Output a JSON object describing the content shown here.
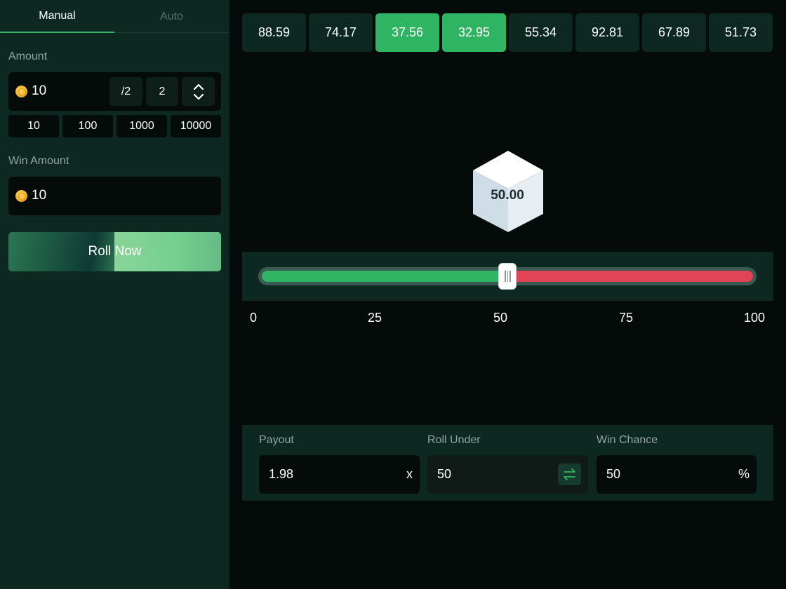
{
  "sidebar": {
    "tabs": [
      {
        "label": "Manual",
        "active": true
      },
      {
        "label": "Auto",
        "active": false
      }
    ],
    "amount": {
      "label": "Amount",
      "value": "10",
      "half_label": "/2",
      "double_label": "2",
      "presets": [
        "10",
        "100",
        "1000",
        "10000"
      ]
    },
    "win_amount": {
      "label": "Win Amount",
      "value": "10"
    },
    "roll_button_label": "Roll Now"
  },
  "history": [
    {
      "value": "88.59",
      "win": false
    },
    {
      "value": "74.17",
      "win": false
    },
    {
      "value": "37.56",
      "win": true
    },
    {
      "value": "32.95",
      "win": true
    },
    {
      "value": "55.34",
      "win": false
    },
    {
      "value": "92.81",
      "win": false
    },
    {
      "value": "67.89",
      "win": false
    },
    {
      "value": "51.73",
      "win": false
    }
  ],
  "dice": {
    "value": "50.00"
  },
  "slider": {
    "value": 50,
    "ticks": [
      "0",
      "25",
      "50",
      "75",
      "100"
    ]
  },
  "controls": {
    "payout": {
      "label": "Payout",
      "value": "1.98",
      "suffix": "x"
    },
    "roll_under": {
      "label": "Roll Under",
      "value": "50"
    },
    "win_chance": {
      "label": "Win Chance",
      "value": "50",
      "suffix": "%"
    }
  },
  "colors": {
    "accent_green": "#2fb463",
    "lose_red": "#e04456",
    "panel": "#0d2820",
    "background": "#050b09"
  },
  "icons": {
    "coin": "coin-icon",
    "stepper": "chevron-up-down-icon",
    "swap": "swap-arrows-icon"
  }
}
